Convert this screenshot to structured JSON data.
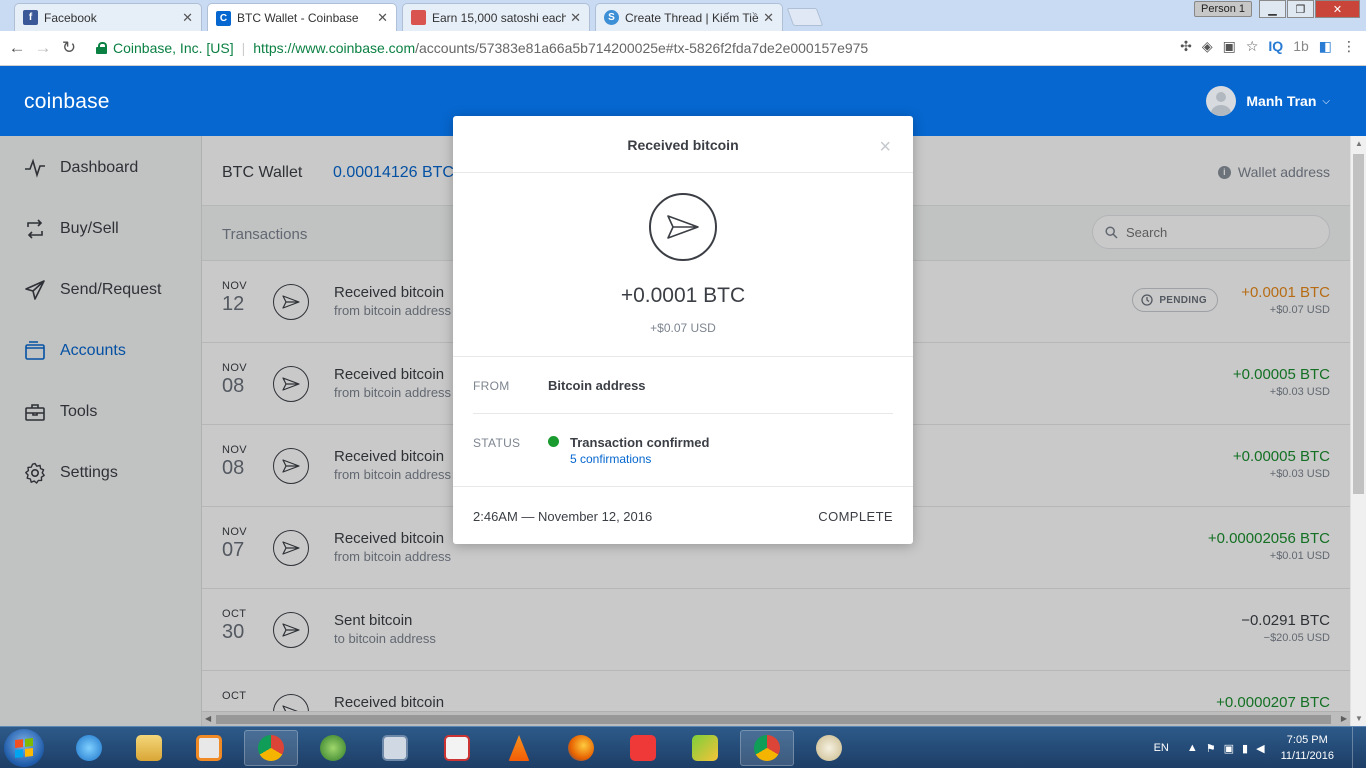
{
  "browser": {
    "tabs": [
      {
        "title": "Facebook",
        "favicon_letter": "f",
        "favicon_color": "#3b5998"
      },
      {
        "title": "BTC Wallet - Coinbase",
        "favicon_letter": "C",
        "favicon_color": "#0667d0"
      },
      {
        "title": "Earn 15,000 satoshi each",
        "favicon_letter": "",
        "favicon_color": "#d9534f"
      },
      {
        "title": "Create Thread | Kiếm Tiề",
        "favicon_letter": "S",
        "favicon_color": "#3d8fd6"
      }
    ],
    "profile_label": "Person 1",
    "site_identity": "Coinbase, Inc. [US]",
    "url_host": "https://www.coinbase.com",
    "url_path": "/accounts/57383e81a66a5b714200025e#tx-5826f2fda7de2e000157e975"
  },
  "header": {
    "logo": "coinbase",
    "user_name": "Manh Tran"
  },
  "sidebar": {
    "items": [
      {
        "label": "Dashboard"
      },
      {
        "label": "Buy/Sell"
      },
      {
        "label": "Send/Request"
      },
      {
        "label": "Accounts"
      },
      {
        "label": "Tools"
      },
      {
        "label": "Settings"
      }
    ],
    "active": "Accounts"
  },
  "wallet": {
    "name": "BTC Wallet",
    "balance": "0.00014126 BTC",
    "address_label": "Wallet address"
  },
  "transactions": {
    "title": "Transactions",
    "search_placeholder": "Search",
    "pending_label": "PENDING",
    "rows": [
      {
        "month": "NOV",
        "day": "12",
        "label": "Received bitcoin",
        "sub": "from bitcoin address",
        "amount": "+0.0001 BTC",
        "usd": "+$0.07 USD",
        "status": "pending"
      },
      {
        "month": "NOV",
        "day": "08",
        "label": "Received bitcoin",
        "sub": "from bitcoin address",
        "amount": "+0.00005 BTC",
        "usd": "+$0.03 USD",
        "status": "received"
      },
      {
        "month": "NOV",
        "day": "08",
        "label": "Received bitcoin",
        "sub": "from bitcoin address",
        "amount": "+0.00005 BTC",
        "usd": "+$0.03 USD",
        "status": "received"
      },
      {
        "month": "NOV",
        "day": "07",
        "label": "Received bitcoin",
        "sub": "from bitcoin address",
        "amount": "+0.00002056 BTC",
        "usd": "+$0.01 USD",
        "status": "received"
      },
      {
        "month": "OCT",
        "day": "30",
        "label": "Sent bitcoin",
        "sub": "to bitcoin address",
        "amount": "−0.0291 BTC",
        "usd": "−$20.05 USD",
        "status": "sent"
      },
      {
        "month": "OCT",
        "day": "",
        "label": "Received bitcoin",
        "sub": "",
        "amount": "+0.0000207 BTC",
        "usd": "",
        "status": "received"
      }
    ]
  },
  "modal": {
    "title": "Received bitcoin",
    "amount": "+0.0001 BTC",
    "usd": "+$0.07 USD",
    "from_key": "FROM",
    "from_value": "Bitcoin address",
    "status_key": "STATUS",
    "status_value": "Transaction confirmed",
    "confirmations": "5 confirmations",
    "timestamp": "2:46AM — November 12, 2016",
    "state": "COMPLETE"
  },
  "taskbar": {
    "language": "EN",
    "time": "7:05 PM",
    "date": "11/11/2016"
  },
  "colors": {
    "brand_blue": "#0667d0",
    "pending_orange": "#e88a1a",
    "received_green": "#1a8f2e",
    "status_dot": "#1a9b2f"
  }
}
